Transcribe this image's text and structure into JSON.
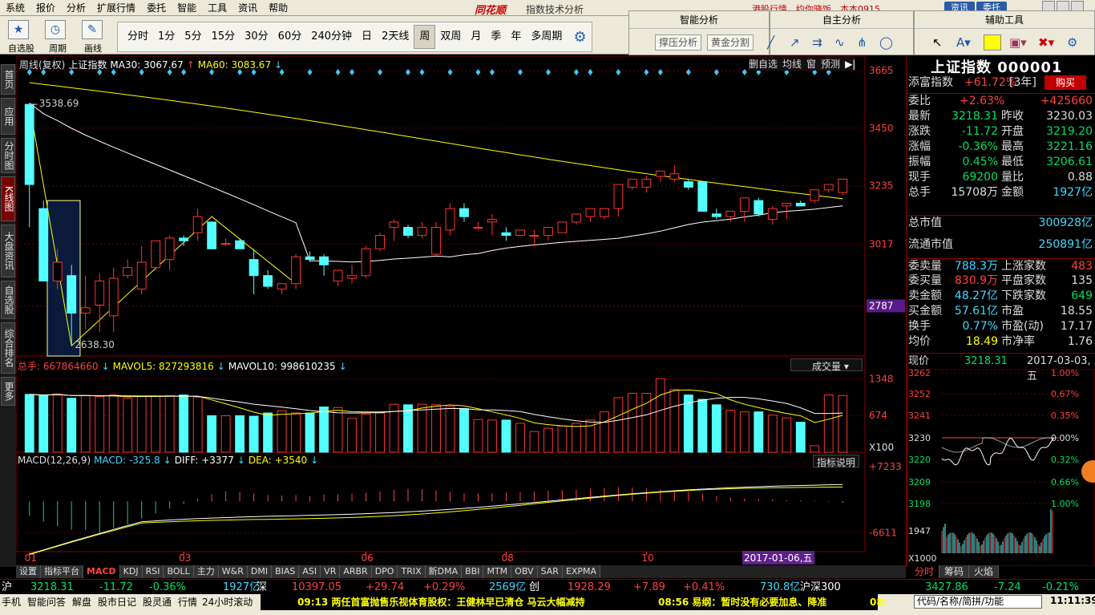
{
  "menu": [
    "系统",
    "报价",
    "分析",
    "扩展行情",
    "委托",
    "智能",
    "工具",
    "资讯",
    "帮助"
  ],
  "logo": "同花顺",
  "window_title": "指数技术分析",
  "notice": "港股行情，约你晓饭",
  "user": "本本0915",
  "top_btns": [
    "资讯",
    "委托"
  ],
  "toolbar": {
    "icons": [
      {
        "label": "自选股"
      },
      {
        "label": "周期"
      },
      {
        "label": "画线"
      }
    ],
    "periods": [
      "分时",
      "1分",
      "5分",
      "15分",
      "30分",
      "60分",
      "240分钟",
      "日",
      "2天线",
      "周",
      "双周",
      "月",
      "季",
      "年",
      "多周期"
    ],
    "active_period": "周"
  },
  "panels": {
    "smart": "智能分析",
    "smart_btns": [
      "撑压分析",
      "黄金分割"
    ],
    "custom": "自主分析",
    "aux": "辅助工具"
  },
  "sidebar": [
    "首页",
    "应用",
    "分时图",
    "K线图",
    "大盘资讯",
    "自选股",
    "综合排名",
    "更多"
  ],
  "chart": {
    "header": [
      {
        "t": "周线(复权)",
        "c": "#ddd"
      },
      {
        "t": "上证指数",
        "c": "#fff"
      },
      {
        "t": "MA30: 3067.67",
        "c": "#fff"
      },
      {
        "t": "↑",
        "c": "#ff4040"
      },
      {
        "t": "MA60: 3083.67",
        "c": "#ffff00"
      },
      {
        "t": "↓",
        "c": "#40d8ff"
      }
    ],
    "right_btns": [
      "删自选",
      "均线",
      "窗",
      "预测"
    ],
    "price_axis": [
      "3665",
      "3450",
      "3235",
      "3017",
      "2787"
    ],
    "high_label": "3538.69",
    "low_label": "2638.30",
    "vol_header": [
      {
        "t": "总手: 667864660",
        "c": "#ff4040"
      },
      {
        "t": "↓",
        "c": "#40d8ff"
      },
      {
        "t": "MAVOL5: 827293816",
        "c": "#ffff00"
      },
      {
        "t": "↓",
        "c": "#40d8ff"
      },
      {
        "t": "MAVOL10: 998610235",
        "c": "#fff"
      },
      {
        "t": "↓",
        "c": "#40d8ff"
      }
    ],
    "vol_dropdown": "成交量",
    "vol_axis": [
      "1348",
      "674",
      "X100"
    ],
    "macd_header": [
      {
        "t": "MACD(12,26,9)",
        "c": "#ddd"
      },
      {
        "t": "MACD: -325.8",
        "c": "#40d8ff"
      },
      {
        "t": "↓",
        "c": "#40d8ff"
      },
      {
        "t": "DIFF: +3377",
        "c": "#fff"
      },
      {
        "t": "↓",
        "c": "#40d8ff"
      },
      {
        "t": "DEA: +3540",
        "c": "#ffff00"
      },
      {
        "t": "↓",
        "c": "#40d8ff"
      }
    ],
    "macd_btn": "指标说明",
    "macd_axis": [
      "+7233",
      "-6611"
    ],
    "x_labels": [
      "01",
      "03",
      "06",
      "08",
      "10"
    ],
    "cursor_date": "2017-01-06,五"
  },
  "chart_data": {
    "type": "candlestick",
    "ohlc": [
      [
        3539,
        3539,
        3080,
        3240
      ],
      [
        3150,
        3180,
        2880,
        2880
      ],
      [
        2880,
        3000,
        2850,
        2950
      ],
      [
        2900,
        2940,
        2638,
        2760
      ],
      [
        2760,
        2900,
        2700,
        2780
      ],
      [
        2790,
        2910,
        2690,
        2880
      ],
      [
        2750,
        2930,
        2690,
        2890
      ],
      [
        2900,
        2960,
        2890,
        2930
      ],
      [
        2850,
        3010,
        2830,
        2950
      ],
      [
        2930,
        3020,
        2920,
        3030
      ],
      [
        2960,
        3050,
        2920,
        3040
      ],
      [
        3040,
        3050,
        3010,
        3030
      ],
      [
        3060,
        3150,
        3030,
        3120
      ],
      [
        3100,
        3100,
        3000,
        3000
      ],
      [
        3020,
        3040,
        3010,
        3020
      ],
      [
        3030,
        3040,
        3000,
        3000
      ],
      [
        2960,
        3000,
        2830,
        2900
      ],
      [
        2900,
        2920,
        2850,
        2860
      ],
      [
        2850,
        2870,
        2830,
        2870
      ],
      [
        2870,
        2980,
        2850,
        2970
      ],
      [
        2970,
        2990,
        2950,
        2960
      ],
      [
        2970,
        2980,
        2900,
        2940
      ],
      [
        2880,
        2900,
        2860,
        2920
      ],
      [
        2890,
        2940,
        2870,
        2900
      ],
      [
        2900,
        3010,
        2890,
        3000
      ],
      [
        3000,
        3060,
        2990,
        3050
      ],
      [
        3080,
        3110,
        3030,
        3100
      ],
      [
        3080,
        3090,
        3040,
        3050
      ],
      [
        3050,
        3100,
        3040,
        3080
      ],
      [
        2980,
        3100,
        2970,
        3080
      ],
      [
        3070,
        3170,
        3050,
        3150
      ],
      [
        3150,
        3170,
        3100,
        3120
      ],
      [
        3080,
        3100,
        3070,
        3080
      ],
      [
        3100,
        3130,
        3050,
        3110
      ],
      [
        3060,
        3080,
        3030,
        3050
      ],
      [
        3050,
        3070,
        3050,
        3070
      ],
      [
        3050,
        3070,
        3010,
        3050
      ],
      [
        3050,
        3070,
        3030,
        3080
      ],
      [
        3060,
        3090,
        3060,
        3100
      ],
      [
        3100,
        3120,
        3090,
        3130
      ],
      [
        3120,
        3150,
        3100,
        3150
      ],
      [
        3120,
        3150,
        3110,
        3150
      ],
      [
        3150,
        3240,
        3120,
        3240
      ],
      [
        3230,
        3250,
        3220,
        3260
      ],
      [
        3230,
        3270,
        3210,
        3260
      ],
      [
        3270,
        3290,
        3250,
        3290
      ],
      [
        3260,
        3310,
        3250,
        3280
      ],
      [
        3250,
        3260,
        3220,
        3230
      ],
      [
        3250,
        3250,
        3150,
        3140
      ],
      [
        3130,
        3150,
        3110,
        3120
      ],
      [
        3120,
        3140,
        3100,
        3140
      ],
      [
        3140,
        3180,
        3100,
        3190
      ],
      [
        3180,
        3190,
        3120,
        3130
      ],
      [
        3110,
        3160,
        3090,
        3150
      ],
      [
        3160,
        3170,
        3110,
        3170
      ],
      [
        3170,
        3180,
        3160,
        3160
      ],
      [
        3180,
        3220,
        3170,
        3220
      ],
      [
        3220,
        3240,
        3210,
        3240
      ],
      [
        3210,
        3260,
        3200,
        3260
      ]
    ],
    "volume": [
      1060,
      1040,
      1070,
      990,
      1040,
      1020,
      1050,
      990,
      1020,
      1030,
      1040,
      1050,
      1010,
      670,
      670,
      670,
      660,
      720,
      760,
      720,
      720,
      830,
      820,
      620,
      700,
      720,
      880,
      870,
      880,
      870,
      840,
      800,
      600,
      590,
      590,
      530,
      380,
      440,
      480,
      530,
      590,
      740,
      1000,
      1080,
      1080,
      1350,
      1150,
      1050,
      970,
      870,
      770,
      740,
      740,
      680,
      630,
      550,
      120,
      1050,
      1040
    ],
    "macd_bars": [
      -3000,
      -4200,
      -5200,
      -5900,
      -6000,
      -6611,
      -5600,
      -4800,
      -3600,
      -2500,
      -1500,
      -500,
      500,
      1500,
      2100,
      1900,
      1600,
      1300,
      1200,
      1300,
      1100,
      1400,
      1500,
      1600,
      1800,
      2100,
      2400,
      2600,
      2500,
      2300,
      2000,
      1700,
      1600,
      1700,
      1800,
      1900,
      2000,
      2200,
      2300,
      2400,
      2700,
      2800,
      3000,
      2900,
      2700,
      2400,
      2200,
      2000,
      1500,
      1100,
      800,
      600,
      500,
      400,
      300,
      200,
      100,
      -100,
      -325.8
    ],
    "ma30_desc": "MA30",
    "ma60_desc": "MA60"
  },
  "quote": {
    "title": "上证指数 000001",
    "top": [
      {
        "l": "添富指数",
        "v": "+61.72%",
        "x": "[3年]",
        "b": "购买"
      }
    ],
    "weibi": {
      "l": "委比",
      "v": "+2.63%",
      "v2": "+425660"
    },
    "grid": [
      [
        "最新",
        "3218.31",
        "昨收",
        "3230.03"
      ],
      [
        "涨跌",
        "-11.72",
        "开盘",
        "3219.20"
      ],
      [
        "涨幅",
        "-0.36%",
        "最高",
        "3221.16"
      ],
      [
        "振幅",
        "0.45%",
        "最低",
        "3206.61"
      ],
      [
        "现手",
        "69200",
        "量比",
        "0.88"
      ],
      [
        "总手",
        "15708万",
        "金额",
        "1927亿"
      ]
    ],
    "mcap": [
      [
        "总市值",
        "300928亿"
      ],
      [
        "流通市值",
        "250891亿"
      ]
    ],
    "grid2": [
      [
        "委卖量",
        "788.3万",
        "上涨家数",
        "483"
      ],
      [
        "委买量",
        "830.9万",
        "平盘家数",
        "135"
      ],
      [
        "卖金额",
        "48.27亿",
        "下跌家数",
        "649"
      ],
      [
        "买金额",
        "57.61亿",
        "市盈",
        "18.55"
      ],
      [
        "换手",
        "0.77%",
        "市盈(动)",
        "17.17"
      ],
      [
        "均价",
        "18.49",
        "市净率",
        "1.76"
      ]
    ],
    "mini_header": {
      "l": "现价",
      "v": "3218.31",
      "d": "2017-03-03,五"
    },
    "mini_y": [
      "3262",
      "3252",
      "3241",
      "3230",
      "3220",
      "3209",
      "3198",
      "1947",
      "X1000"
    ],
    "mini_pct": [
      "1.00%",
      "0.67%",
      "0.35%",
      "0.00%",
      "0.32%",
      "0.66%",
      "1.00%"
    ],
    "tabs": [
      "分时",
      "筹码",
      "火焰"
    ]
  },
  "indicator_tabs": [
    "设置",
    "指标平台",
    "MACD",
    "KDJ",
    "RSI",
    "BOLL",
    "主力",
    "W&R",
    "DMI",
    "BIAS",
    "ASI",
    "VR",
    "ARBR",
    "DPO",
    "TRIX",
    "新DMA",
    "BBI",
    "MTM",
    "OBV",
    "SAR",
    "EXPMA"
  ],
  "status1": [
    {
      "t": "沪",
      "c": "#fff"
    },
    {
      "t": "3218.31",
      "c": "#00e060"
    },
    {
      "t": "-11.72",
      "c": "#00e060"
    },
    {
      "t": "-0.36%",
      "c": "#00e060"
    },
    {
      "t": "1927亿",
      "c": "#40d8ff"
    },
    {
      "t": "深",
      "c": "#fff"
    },
    {
      "t": "10397.05",
      "c": "#ff4040"
    },
    {
      "t": "+29.74",
      "c": "#ff4040"
    },
    {
      "t": "+0.29%",
      "c": "#ff4040"
    },
    {
      "t": "2569亿",
      "c": "#40d8ff"
    },
    {
      "t": "创",
      "c": "#fff"
    },
    {
      "t": "1928.29",
      "c": "#ff4040"
    },
    {
      "t": "+7.89",
      "c": "#ff4040"
    },
    {
      "t": "+0.41%",
      "c": "#ff4040"
    },
    {
      "t": "730.8亿",
      "c": "#40d8ff"
    },
    {
      "t": "沪深300",
      "c": "#fff"
    },
    {
      "t": "3427.86",
      "c": "#00e060"
    },
    {
      "t": "-7.24",
      "c": "#00e060"
    },
    {
      "t": "-0.21%",
      "c": "#00e060"
    }
  ],
  "status2": [
    "手机",
    "智能问答",
    "解盘",
    "股市日记",
    "股灵通",
    "行情",
    "24小时滚动"
  ],
  "news": [
    "09:13 两任首富抛售乐视体育股权：王健林早已清仓 马云大幅减持",
    "08:56 易纲：暂时没有必要加息、降准",
    "08:"
  ],
  "code_box": "代码/名称/简拼/功能",
  "clock": "11:11:39",
  "colors": {
    "up": "#ff3232",
    "down": "#54ffff",
    "ma30": "#ffffff",
    "ma60": "#ffff00",
    "accent": "#c00000"
  }
}
